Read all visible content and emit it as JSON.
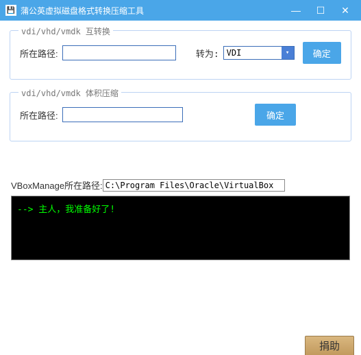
{
  "titlebar": {
    "title": "蒲公英虚拟磁盘格式转换压缩工具",
    "icon_glyph": "💾"
  },
  "group_convert": {
    "legend": "vdi/vhd/vmdk 互转换",
    "path_label": "所在路径:",
    "path_value": "",
    "to_label": "转为:",
    "select_value": "VDI",
    "confirm": "确定"
  },
  "group_compress": {
    "legend": "vdi/vhd/vmdk 体积压缩",
    "path_label": "所在路径:",
    "path_value": "",
    "confirm": "确定"
  },
  "vbox": {
    "label": "VBoxManage所在路径:",
    "value": "C:\\Program Files\\Oracle\\VirtualBox"
  },
  "console": {
    "line1": "--> 主人，我准备好了!"
  },
  "footer": {
    "donate": "捐助"
  }
}
